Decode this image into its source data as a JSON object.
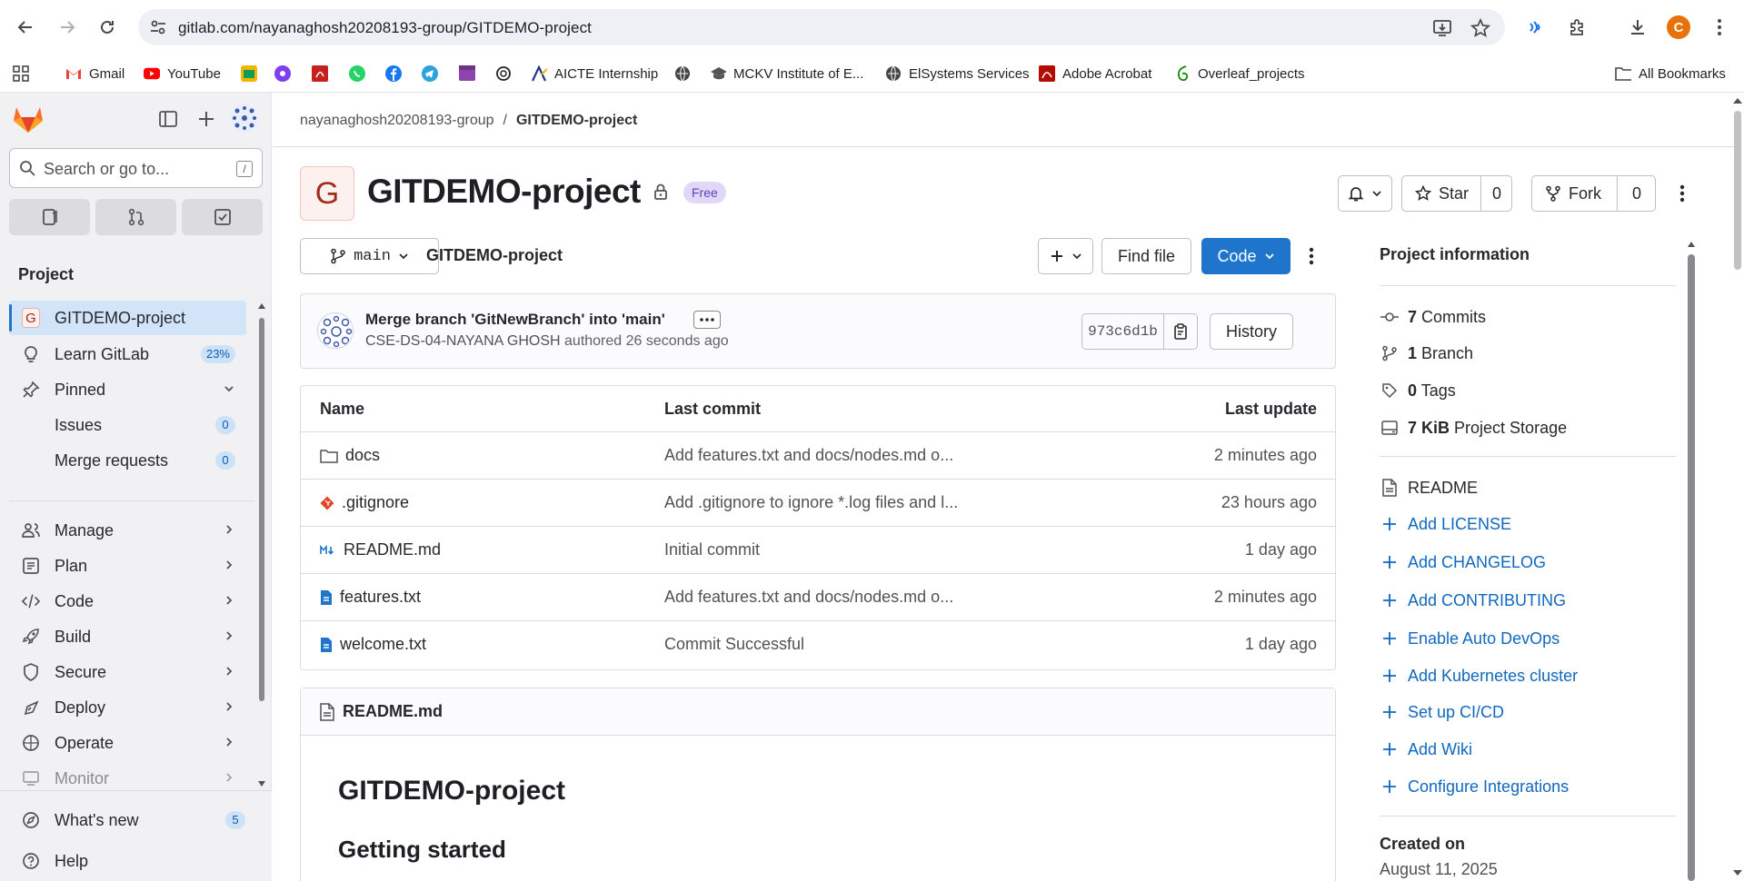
{
  "browser": {
    "url": "gitlab.com/nayanaghosh20208193-group/GITDEMO-project",
    "profile_initial": "C",
    "bookmarks": [
      {
        "label": "Gmail",
        "icon": "gmail-icon"
      },
      {
        "label": "YouTube",
        "icon": "youtube-icon"
      },
      {
        "label": "",
        "icon": "photo-icon"
      },
      {
        "label": "",
        "icon": "purple-circle-icon"
      },
      {
        "label": "",
        "icon": "pdf-icon"
      },
      {
        "label": "",
        "icon": "whatsapp-icon"
      },
      {
        "label": "",
        "icon": "facebook-icon"
      },
      {
        "label": "",
        "icon": "telegram-icon"
      },
      {
        "label": "",
        "icon": "clapper-icon"
      },
      {
        "label": "",
        "icon": "openai-icon"
      },
      {
        "label": "AICTE Internship",
        "icon": "aicte-icon"
      },
      {
        "label": "",
        "icon": "globe-icon"
      },
      {
        "label": "MCKV Institute of E...",
        "icon": "mortarboard-icon"
      },
      {
        "label": "ElSystems Services",
        "icon": "globe-icon"
      },
      {
        "label": "Adobe Acrobat",
        "icon": "acrobat-icon"
      },
      {
        "label": "Overleaf_projects",
        "icon": "overleaf-icon"
      }
    ],
    "all_bookmarks": "All Bookmarks"
  },
  "sidebar": {
    "search_placeholder": "Search or go to...",
    "search_shortcut": "/",
    "section_title": "Project",
    "project_initial": "G",
    "project_name": "GITDEMO-project",
    "learn_label": "Learn GitLab",
    "learn_progress": "23%",
    "pinned_label": "Pinned",
    "issues_label": "Issues",
    "issues_count": "0",
    "mr_label": "Merge requests",
    "mr_count": "0",
    "groups": [
      {
        "label": "Manage",
        "icon": "manage-icon"
      },
      {
        "label": "Plan",
        "icon": "plan-icon"
      },
      {
        "label": "Code",
        "icon": "code-icon"
      },
      {
        "label": "Build",
        "icon": "rocket-icon"
      },
      {
        "label": "Secure",
        "icon": "shield-icon"
      },
      {
        "label": "Deploy",
        "icon": "deploy-icon"
      },
      {
        "label": "Operate",
        "icon": "operate-icon"
      },
      {
        "label": "Monitor",
        "icon": "monitor-icon"
      }
    ],
    "whats_new_label": "What's new",
    "whats_new_count": "5",
    "help_label": "Help"
  },
  "breadcrumb": {
    "group": "nayanaghosh20208193-group",
    "separator": "/",
    "project": "GITDEMO-project"
  },
  "project": {
    "initial": "G",
    "title": "GITDEMO-project",
    "plan_badge": "Free",
    "star_label": "Star",
    "star_count": "0",
    "fork_label": "Fork",
    "fork_count": "0"
  },
  "repo_bar": {
    "branch": "main",
    "path": "GITDEMO-project",
    "find_file": "Find file",
    "code": "Code"
  },
  "last_commit": {
    "title": "Merge branch 'GitNewBranch' into 'main'",
    "author": "CSE-DS-04-NAYANA GHOSH",
    "action": "authored",
    "time": "26 seconds ago",
    "sha": "973c6d1b",
    "history": "History"
  },
  "file_table": {
    "headers": {
      "name": "Name",
      "last_commit": "Last commit",
      "last_update": "Last update"
    },
    "rows": [
      {
        "name": "docs",
        "icon": "folder-icon",
        "commit": "Add features.txt and docs/nodes.md o...",
        "updated": "2 minutes ago"
      },
      {
        "name": ".gitignore",
        "icon": "git-icon",
        "commit": "Add .gitignore to ignore *.log files and l...",
        "updated": "23 hours ago"
      },
      {
        "name": "README.md",
        "icon": "markdown-icon",
        "commit": "Initial commit",
        "updated": "1 day ago"
      },
      {
        "name": "features.txt",
        "icon": "text-file-icon",
        "commit": "Add features.txt and docs/nodes.md o...",
        "updated": "2 minutes ago"
      },
      {
        "name": "welcome.txt",
        "icon": "text-file-icon",
        "commit": "Commit Successful",
        "updated": "1 day ago"
      }
    ]
  },
  "readme": {
    "filename": "README.md",
    "h1": "GITDEMO-project",
    "h2": "Getting started"
  },
  "project_info": {
    "title": "Project information",
    "commits_count": "7",
    "commits_label": "Commits",
    "branch_count": "1",
    "branch_label": "Branch",
    "tags_count": "0",
    "tags_label": "Tags",
    "storage_size": "7 KiB",
    "storage_label": "Project Storage",
    "readme_label": "README",
    "actions": [
      "Add LICENSE",
      "Add CHANGELOG",
      "Add CONTRIBUTING",
      "Enable Auto DevOps",
      "Add Kubernetes cluster",
      "Set up CI/CD",
      "Add Wiki",
      "Configure Integrations"
    ],
    "created_label": "Created on",
    "created_date": "August 11, 2025"
  },
  "colors": {
    "brand_blue": "#1f75cb",
    "link_blue": "#1068bf",
    "sidebar_bg": "#f1f1f3",
    "free_badge": "#e1d8f9"
  }
}
